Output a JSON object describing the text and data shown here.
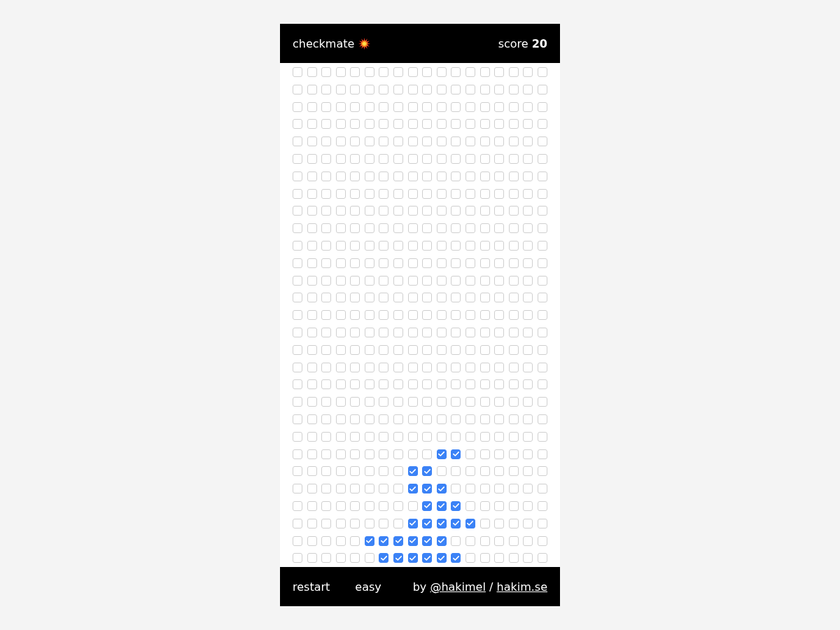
{
  "header": {
    "title": "checkmate",
    "score": "score **20**"
  },
  "grid": {
    "rows": [
      {
        "cells": [
          {
            "checked": false
          },
          {
            "checked": false
          },
          {
            "checked": false
          },
          {
            "checked": false
          },
          {
            "checked": false
          },
          {
            "checked": false
          },
          {
            "checked": false
          },
          {
            "checked": false
          },
          {
            "checked": false
          },
          {
            "checked": false
          },
          {
            "checked": false
          },
          {
            "checked": false
          },
          {
            "checked": false
          },
          {
            "checked": false
          },
          {
            "checked": false
          },
          {
            "checked": false
          },
          {
            "checked": false
          },
          {
            "checked": false
          }
        ]
      },
      {
        "cells": [
          {
            "checked": false
          },
          {
            "checked": false
          },
          {
            "checked": false
          },
          {
            "checked": false
          },
          {
            "checked": false
          },
          {
            "checked": false
          },
          {
            "checked": false
          },
          {
            "checked": false
          },
          {
            "checked": false
          },
          {
            "checked": false
          },
          {
            "checked": false
          },
          {
            "checked": false
          },
          {
            "checked": false
          },
          {
            "checked": false
          },
          {
            "checked": false
          },
          {
            "checked": false
          },
          {
            "checked": false
          },
          {
            "checked": false
          }
        ]
      },
      {
        "cells": [
          {
            "checked": false
          },
          {
            "checked": false
          },
          {
            "checked": false
          },
          {
            "checked": false
          },
          {
            "checked": false
          },
          {
            "checked": false
          },
          {
            "checked": false
          },
          {
            "checked": false
          },
          {
            "checked": false
          },
          {
            "checked": false
          },
          {
            "checked": false
          },
          {
            "checked": false
          },
          {
            "checked": false
          },
          {
            "checked": false
          },
          {
            "checked": false
          },
          {
            "checked": false
          },
          {
            "checked": false
          },
          {
            "checked": false
          }
        ]
      },
      {
        "cells": [
          {
            "checked": false
          },
          {
            "checked": false
          },
          {
            "checked": false
          },
          {
            "checked": false
          },
          {
            "checked": false
          },
          {
            "checked": false
          },
          {
            "checked": false
          },
          {
            "checked": false
          },
          {
            "checked": false
          },
          {
            "checked": false
          },
          {
            "checked": false
          },
          {
            "checked": false
          },
          {
            "checked": false
          },
          {
            "checked": false
          },
          {
            "checked": false
          },
          {
            "checked": false
          },
          {
            "checked": false
          },
          {
            "checked": false
          }
        ]
      },
      {
        "cells": [
          {
            "checked": false
          },
          {
            "checked": false
          },
          {
            "checked": false
          },
          {
            "checked": false
          },
          {
            "checked": false
          },
          {
            "checked": false
          },
          {
            "checked": false
          },
          {
            "checked": false
          },
          {
            "checked": false
          },
          {
            "checked": false
          },
          {
            "checked": false
          },
          {
            "checked": false
          },
          {
            "checked": false
          },
          {
            "checked": false
          },
          {
            "checked": false
          },
          {
            "checked": false
          },
          {
            "checked": false
          },
          {
            "checked": false
          }
        ]
      },
      {
        "cells": [
          {
            "checked": false
          },
          {
            "checked": false
          },
          {
            "checked": false
          },
          {
            "checked": false
          },
          {
            "checked": false
          },
          {
            "checked": false
          },
          {
            "checked": false
          },
          {
            "checked": false
          },
          {
            "checked": false
          },
          {
            "checked": false
          },
          {
            "checked": false
          },
          {
            "checked": false
          },
          {
            "checked": false
          },
          {
            "checked": false
          },
          {
            "checked": false
          },
          {
            "checked": false
          },
          {
            "checked": false
          },
          {
            "checked": false
          }
        ]
      },
      {
        "cells": [
          {
            "checked": false
          },
          {
            "checked": false
          },
          {
            "checked": false
          },
          {
            "checked": false
          },
          {
            "checked": false
          },
          {
            "checked": false
          },
          {
            "checked": false
          },
          {
            "checked": false
          },
          {
            "checked": false
          },
          {
            "checked": false
          },
          {
            "checked": false
          },
          {
            "checked": false
          },
          {
            "checked": false
          },
          {
            "checked": false
          },
          {
            "checked": false
          },
          {
            "checked": false
          },
          {
            "checked": false
          },
          {
            "checked": false
          }
        ]
      },
      {
        "cells": [
          {
            "checked": false
          },
          {
            "checked": false
          },
          {
            "checked": false
          },
          {
            "checked": false
          },
          {
            "checked": false
          },
          {
            "checked": false
          },
          {
            "checked": false
          },
          {
            "checked": false
          },
          {
            "checked": false
          },
          {
            "checked": false
          },
          {
            "checked": false
          },
          {
            "checked": false
          },
          {
            "checked": false
          },
          {
            "checked": false
          },
          {
            "checked": false
          },
          {
            "checked": false
          },
          {
            "checked": false
          },
          {
            "checked": false
          }
        ]
      },
      {
        "cells": [
          {
            "checked": false
          },
          {
            "checked": false
          },
          {
            "checked": false
          },
          {
            "checked": false
          },
          {
            "checked": false
          },
          {
            "checked": false
          },
          {
            "checked": false
          },
          {
            "checked": false
          },
          {
            "checked": false
          },
          {
            "checked": false
          },
          {
            "checked": false
          },
          {
            "checked": false
          },
          {
            "checked": false
          },
          {
            "checked": false
          },
          {
            "checked": false
          },
          {
            "checked": false
          },
          {
            "checked": false
          },
          {
            "checked": false
          }
        ]
      },
      {
        "cells": [
          {
            "checked": false
          },
          {
            "checked": false
          },
          {
            "checked": false
          },
          {
            "checked": false
          },
          {
            "checked": false
          },
          {
            "checked": false
          },
          {
            "checked": false
          },
          {
            "checked": false
          },
          {
            "checked": false
          },
          {
            "checked": false
          },
          {
            "checked": false
          },
          {
            "checked": false
          },
          {
            "checked": false
          },
          {
            "checked": false
          },
          {
            "checked": false
          },
          {
            "checked": false
          },
          {
            "checked": false
          },
          {
            "checked": false
          }
        ]
      },
      {
        "cells": [
          {
            "checked": false
          },
          {
            "checked": false
          },
          {
            "checked": false
          },
          {
            "checked": false
          },
          {
            "checked": false
          },
          {
            "checked": false
          },
          {
            "checked": false
          },
          {
            "checked": false
          },
          {
            "checked": false
          },
          {
            "checked": false
          },
          {
            "checked": false
          },
          {
            "checked": false
          },
          {
            "checked": false
          },
          {
            "checked": false
          },
          {
            "checked": false
          },
          {
            "checked": false
          },
          {
            "checked": false
          },
          {
            "checked": false
          }
        ]
      },
      {
        "cells": [
          {
            "checked": false
          },
          {
            "checked": false
          },
          {
            "checked": false
          },
          {
            "checked": false
          },
          {
            "checked": false
          },
          {
            "checked": false
          },
          {
            "checked": false
          },
          {
            "checked": false
          },
          {
            "checked": false
          },
          {
            "checked": false
          },
          {
            "checked": false
          },
          {
            "checked": false
          },
          {
            "checked": false
          },
          {
            "checked": false
          },
          {
            "checked": false
          },
          {
            "checked": false
          },
          {
            "checked": false
          },
          {
            "checked": false
          }
        ]
      },
      {
        "cells": [
          {
            "checked": false
          },
          {
            "checked": false
          },
          {
            "checked": false
          },
          {
            "checked": false
          },
          {
            "checked": false
          },
          {
            "checked": false
          },
          {
            "checked": false
          },
          {
            "checked": false
          },
          {
            "checked": false
          },
          {
            "checked": false
          },
          {
            "checked": false
          },
          {
            "checked": false
          },
          {
            "checked": false
          },
          {
            "checked": false
          },
          {
            "checked": false
          },
          {
            "checked": false
          },
          {
            "checked": false
          },
          {
            "checked": false
          }
        ]
      },
      {
        "cells": [
          {
            "checked": false
          },
          {
            "checked": false
          },
          {
            "checked": false
          },
          {
            "checked": false
          },
          {
            "checked": false
          },
          {
            "checked": false
          },
          {
            "checked": false
          },
          {
            "checked": false
          },
          {
            "checked": false
          },
          {
            "checked": false
          },
          {
            "checked": false
          },
          {
            "checked": false
          },
          {
            "checked": false
          },
          {
            "checked": false
          },
          {
            "checked": false
          },
          {
            "checked": false
          },
          {
            "checked": false
          },
          {
            "checked": false
          }
        ]
      },
      {
        "cells": [
          {
            "checked": false
          },
          {
            "checked": false
          },
          {
            "checked": false
          },
          {
            "checked": false
          },
          {
            "checked": false
          },
          {
            "checked": false
          },
          {
            "checked": false
          },
          {
            "checked": false
          },
          {
            "checked": false
          },
          {
            "checked": false
          },
          {
            "checked": false
          },
          {
            "checked": false
          },
          {
            "checked": false
          },
          {
            "checked": false
          },
          {
            "checked": false
          },
          {
            "checked": false
          },
          {
            "checked": false
          },
          {
            "checked": false
          }
        ]
      },
      {
        "cells": [
          {
            "checked": false
          },
          {
            "checked": false
          },
          {
            "checked": false
          },
          {
            "checked": false
          },
          {
            "checked": false
          },
          {
            "checked": false
          },
          {
            "checked": false
          },
          {
            "checked": false
          },
          {
            "checked": false
          },
          {
            "checked": false
          },
          {
            "checked": false
          },
          {
            "checked": false
          },
          {
            "checked": false
          },
          {
            "checked": false
          },
          {
            "checked": false
          },
          {
            "checked": false
          },
          {
            "checked": false
          },
          {
            "checked": false
          }
        ]
      },
      {
        "cells": [
          {
            "checked": false
          },
          {
            "checked": false
          },
          {
            "checked": false
          },
          {
            "checked": false
          },
          {
            "checked": false
          },
          {
            "checked": false
          },
          {
            "checked": false
          },
          {
            "checked": false
          },
          {
            "checked": false
          },
          {
            "checked": false
          },
          {
            "checked": false
          },
          {
            "checked": false
          },
          {
            "checked": false
          },
          {
            "checked": false
          },
          {
            "checked": false
          },
          {
            "checked": false
          },
          {
            "checked": false
          },
          {
            "checked": false
          }
        ]
      },
      {
        "cells": [
          {
            "checked": false
          },
          {
            "checked": false
          },
          {
            "checked": false
          },
          {
            "checked": false
          },
          {
            "checked": false
          },
          {
            "checked": false
          },
          {
            "checked": false
          },
          {
            "checked": false
          },
          {
            "checked": false
          },
          {
            "checked": false
          },
          {
            "checked": false
          },
          {
            "checked": false
          },
          {
            "checked": false
          },
          {
            "checked": false
          },
          {
            "checked": false
          },
          {
            "checked": false
          },
          {
            "checked": false
          },
          {
            "checked": false
          }
        ]
      },
      {
        "cells": [
          {
            "checked": false
          },
          {
            "checked": false
          },
          {
            "checked": false
          },
          {
            "checked": false
          },
          {
            "checked": false
          },
          {
            "checked": false
          },
          {
            "checked": false
          },
          {
            "checked": false
          },
          {
            "checked": false
          },
          {
            "checked": false
          },
          {
            "checked": false
          },
          {
            "checked": false
          },
          {
            "checked": false
          },
          {
            "checked": false
          },
          {
            "checked": false
          },
          {
            "checked": false
          },
          {
            "checked": false
          },
          {
            "checked": false
          }
        ]
      },
      {
        "cells": [
          {
            "checked": false
          },
          {
            "checked": false
          },
          {
            "checked": false
          },
          {
            "checked": false
          },
          {
            "checked": false
          },
          {
            "checked": false
          },
          {
            "checked": false
          },
          {
            "checked": false
          },
          {
            "checked": false
          },
          {
            "checked": false
          },
          {
            "checked": false
          },
          {
            "checked": false
          },
          {
            "checked": false
          },
          {
            "checked": false
          },
          {
            "checked": false
          },
          {
            "checked": false
          },
          {
            "checked": false
          },
          {
            "checked": false
          }
        ]
      },
      {
        "cells": [
          {
            "checked": false
          },
          {
            "checked": false
          },
          {
            "checked": false
          },
          {
            "checked": false
          },
          {
            "checked": false
          },
          {
            "checked": false
          },
          {
            "checked": false
          },
          {
            "checked": false
          },
          {
            "checked": false
          },
          {
            "checked": false
          },
          {
            "checked": false
          },
          {
            "checked": false
          },
          {
            "checked": false
          },
          {
            "checked": false
          },
          {
            "checked": false
          },
          {
            "checked": false
          },
          {
            "checked": false
          },
          {
            "checked": false
          }
        ]
      },
      {
        "cells": [
          {
            "checked": false
          },
          {
            "checked": false
          },
          {
            "checked": false
          },
          {
            "checked": false
          },
          {
            "checked": false
          },
          {
            "checked": false
          },
          {
            "checked": false
          },
          {
            "checked": false
          },
          {
            "checked": false
          },
          {
            "checked": false
          },
          {
            "checked": false
          },
          {
            "checked": false
          },
          {
            "checked": false
          },
          {
            "checked": false
          },
          {
            "checked": false
          },
          {
            "checked": false
          },
          {
            "checked": false
          },
          {
            "checked": false
          }
        ]
      },
      {
        "cells": [
          {
            "checked": false
          },
          {
            "checked": false
          },
          {
            "checked": false
          },
          {
            "checked": false
          },
          {
            "checked": false
          },
          {
            "checked": false
          },
          {
            "checked": false
          },
          {
            "checked": false
          },
          {
            "checked": false
          },
          {
            "checked": false
          },
          {
            "checked": true
          },
          {
            "checked": true
          },
          {
            "checked": false
          },
          {
            "checked": false
          },
          {
            "checked": false
          },
          {
            "checked": false
          },
          {
            "checked": false
          },
          {
            "checked": false
          }
        ]
      },
      {
        "cells": [
          {
            "checked": false
          },
          {
            "checked": false
          },
          {
            "checked": false
          },
          {
            "checked": false
          },
          {
            "checked": false
          },
          {
            "checked": false
          },
          {
            "checked": false
          },
          {
            "checked": false
          },
          {
            "checked": true
          },
          {
            "checked": true
          },
          {
            "checked": false
          },
          {
            "checked": false
          },
          {
            "checked": false
          },
          {
            "checked": false
          },
          {
            "checked": false
          },
          {
            "checked": false
          },
          {
            "checked": false
          },
          {
            "checked": false
          }
        ]
      },
      {
        "cells": [
          {
            "checked": false
          },
          {
            "checked": false
          },
          {
            "checked": false
          },
          {
            "checked": false
          },
          {
            "checked": false
          },
          {
            "checked": false
          },
          {
            "checked": false
          },
          {
            "checked": false
          },
          {
            "checked": true
          },
          {
            "checked": true
          },
          {
            "checked": true
          },
          {
            "checked": false
          },
          {
            "checked": false
          },
          {
            "checked": false
          },
          {
            "checked": false
          },
          {
            "checked": false
          },
          {
            "checked": false
          },
          {
            "checked": false
          }
        ]
      },
      {
        "cells": [
          {
            "checked": false
          },
          {
            "checked": false
          },
          {
            "checked": false
          },
          {
            "checked": false
          },
          {
            "checked": false
          },
          {
            "checked": false
          },
          {
            "checked": false
          },
          {
            "checked": false
          },
          {
            "checked": false
          },
          {
            "checked": true
          },
          {
            "checked": true
          },
          {
            "checked": true
          },
          {
            "checked": false
          },
          {
            "checked": false
          },
          {
            "checked": false
          },
          {
            "checked": false
          },
          {
            "checked": false
          },
          {
            "checked": false
          }
        ]
      },
      {
        "cells": [
          {
            "checked": false
          },
          {
            "checked": false
          },
          {
            "checked": false
          },
          {
            "checked": false
          },
          {
            "checked": false
          },
          {
            "checked": false
          },
          {
            "checked": false
          },
          {
            "checked": false
          },
          {
            "checked": true
          },
          {
            "checked": true
          },
          {
            "checked": true
          },
          {
            "checked": true
          },
          {
            "checked": true
          },
          {
            "checked": false
          },
          {
            "checked": false
          },
          {
            "checked": false
          },
          {
            "checked": false
          },
          {
            "checked": false
          }
        ]
      },
      {
        "cells": [
          {
            "checked": false
          },
          {
            "checked": false
          },
          {
            "checked": false
          },
          {
            "checked": false
          },
          {
            "checked": false
          },
          {
            "checked": true
          },
          {
            "checked": true
          },
          {
            "checked": true
          },
          {
            "checked": true
          },
          {
            "checked": true
          },
          {
            "checked": true
          },
          {
            "checked": false
          },
          {
            "checked": false
          },
          {
            "checked": false
          },
          {
            "checked": false
          },
          {
            "checked": false
          },
          {
            "checked": false
          },
          {
            "checked": false
          }
        ]
      },
      {
        "cells": [
          {
            "checked": false
          },
          {
            "checked": false
          },
          {
            "checked": false
          },
          {
            "checked": false
          },
          {
            "checked": false
          },
          {
            "checked": false
          },
          {
            "checked": true
          },
          {
            "checked": true
          },
          {
            "checked": true
          },
          {
            "checked": true
          },
          {
            "checked": true
          },
          {
            "checked": true
          },
          {
            "checked": false
          },
          {
            "checked": false
          },
          {
            "checked": false
          },
          {
            "checked": false
          },
          {
            "checked": false
          },
          {
            "checked": false
          }
        ]
      }
    ]
  },
  "footer": {
    "buttons": [
      "restart",
      "easy"
    ],
    "credit": {
      "prefix": "by",
      "links": [
        "@hakimel",
        "hakim.se"
      ],
      "separator": "/"
    }
  }
}
